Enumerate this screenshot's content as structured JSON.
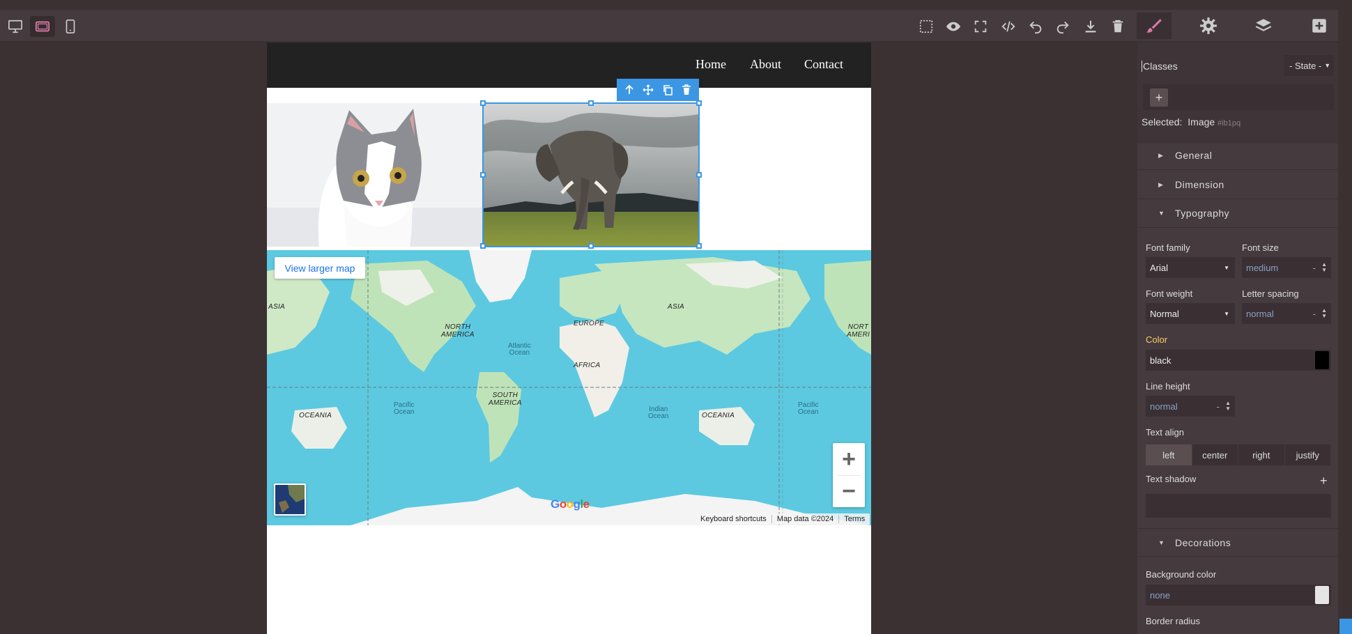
{
  "colors": {
    "accent": "#3b97e3",
    "active_pink": "#d97aa6",
    "panel_bg": "#453a3d",
    "canvas_bg": "#3b3133",
    "color_field_label": "#ffcc66"
  },
  "devices": [
    {
      "name": "desktop-icon",
      "active": false
    },
    {
      "name": "tablet-icon",
      "active": true
    },
    {
      "name": "mobile-icon",
      "active": false
    }
  ],
  "toolbar": {
    "icons": [
      "sw-visibility-icon",
      "preview-icon",
      "fullscreen-icon",
      "code-icon",
      "undo-icon",
      "redo-icon",
      "import-icon",
      "trash-icon"
    ]
  },
  "panels": {
    "icons": [
      "style-manager-icon",
      "settings-icon",
      "layer-manager-icon",
      "blocks-icon"
    ],
    "active": "style-manager-icon"
  },
  "site": {
    "nav": [
      "Home",
      "About",
      "Contact"
    ]
  },
  "selection": {
    "toolbar_icons": [
      "arrow-up-icon",
      "move-icon",
      "clone-icon",
      "delete-icon"
    ]
  },
  "map": {
    "larger_map": "View larger map",
    "zoom_in": "+",
    "zoom_out": "−",
    "google": "Google",
    "attribution": [
      "Keyboard shortcuts",
      "Map data ©2024",
      "Terms"
    ],
    "labels": {
      "asia_left": "ASIA",
      "north_america": "NORTH\nAMERICA",
      "europe": "EUROPE",
      "asia": "ASIA",
      "north_right": "NORT\nAMERI",
      "atlantic": "Atlantic\nOcean",
      "africa": "AFRICA",
      "south_america": "SOUTH\nAMERICA",
      "pacific_left": "Pacific\nOcean",
      "indian": "Indian\nOcean",
      "oceania_left": "OCEANIA",
      "oceania": "OCEANIA",
      "pacific_right": "Pacific\nOcean"
    }
  },
  "style_manager": {
    "classes_label": "Classes",
    "state": "- State -",
    "selected_label": "Selected:",
    "selected_type": "Image",
    "selected_id": "#ib1pq",
    "sectors": [
      "General",
      "Dimension",
      "Typography",
      "Decorations"
    ],
    "typography": {
      "font_family_label": "Font family",
      "font_family": "Arial",
      "font_size_label": "Font size",
      "font_size": "medium",
      "font_weight_label": "Font weight",
      "font_weight": "Normal",
      "letter_spacing_label": "Letter spacing",
      "letter_spacing": "normal",
      "color_label": "Color",
      "color": "black",
      "line_height_label": "Line height",
      "line_height": "normal",
      "text_align_label": "Text align",
      "text_align": [
        "left",
        "center",
        "right",
        "justify"
      ],
      "text_align_selected": "left",
      "text_shadow_label": "Text shadow",
      "unit_dash": "-"
    },
    "decorations": {
      "bg_color_label": "Background color",
      "bg_color": "none",
      "border_radius_label": "Border radius"
    }
  }
}
